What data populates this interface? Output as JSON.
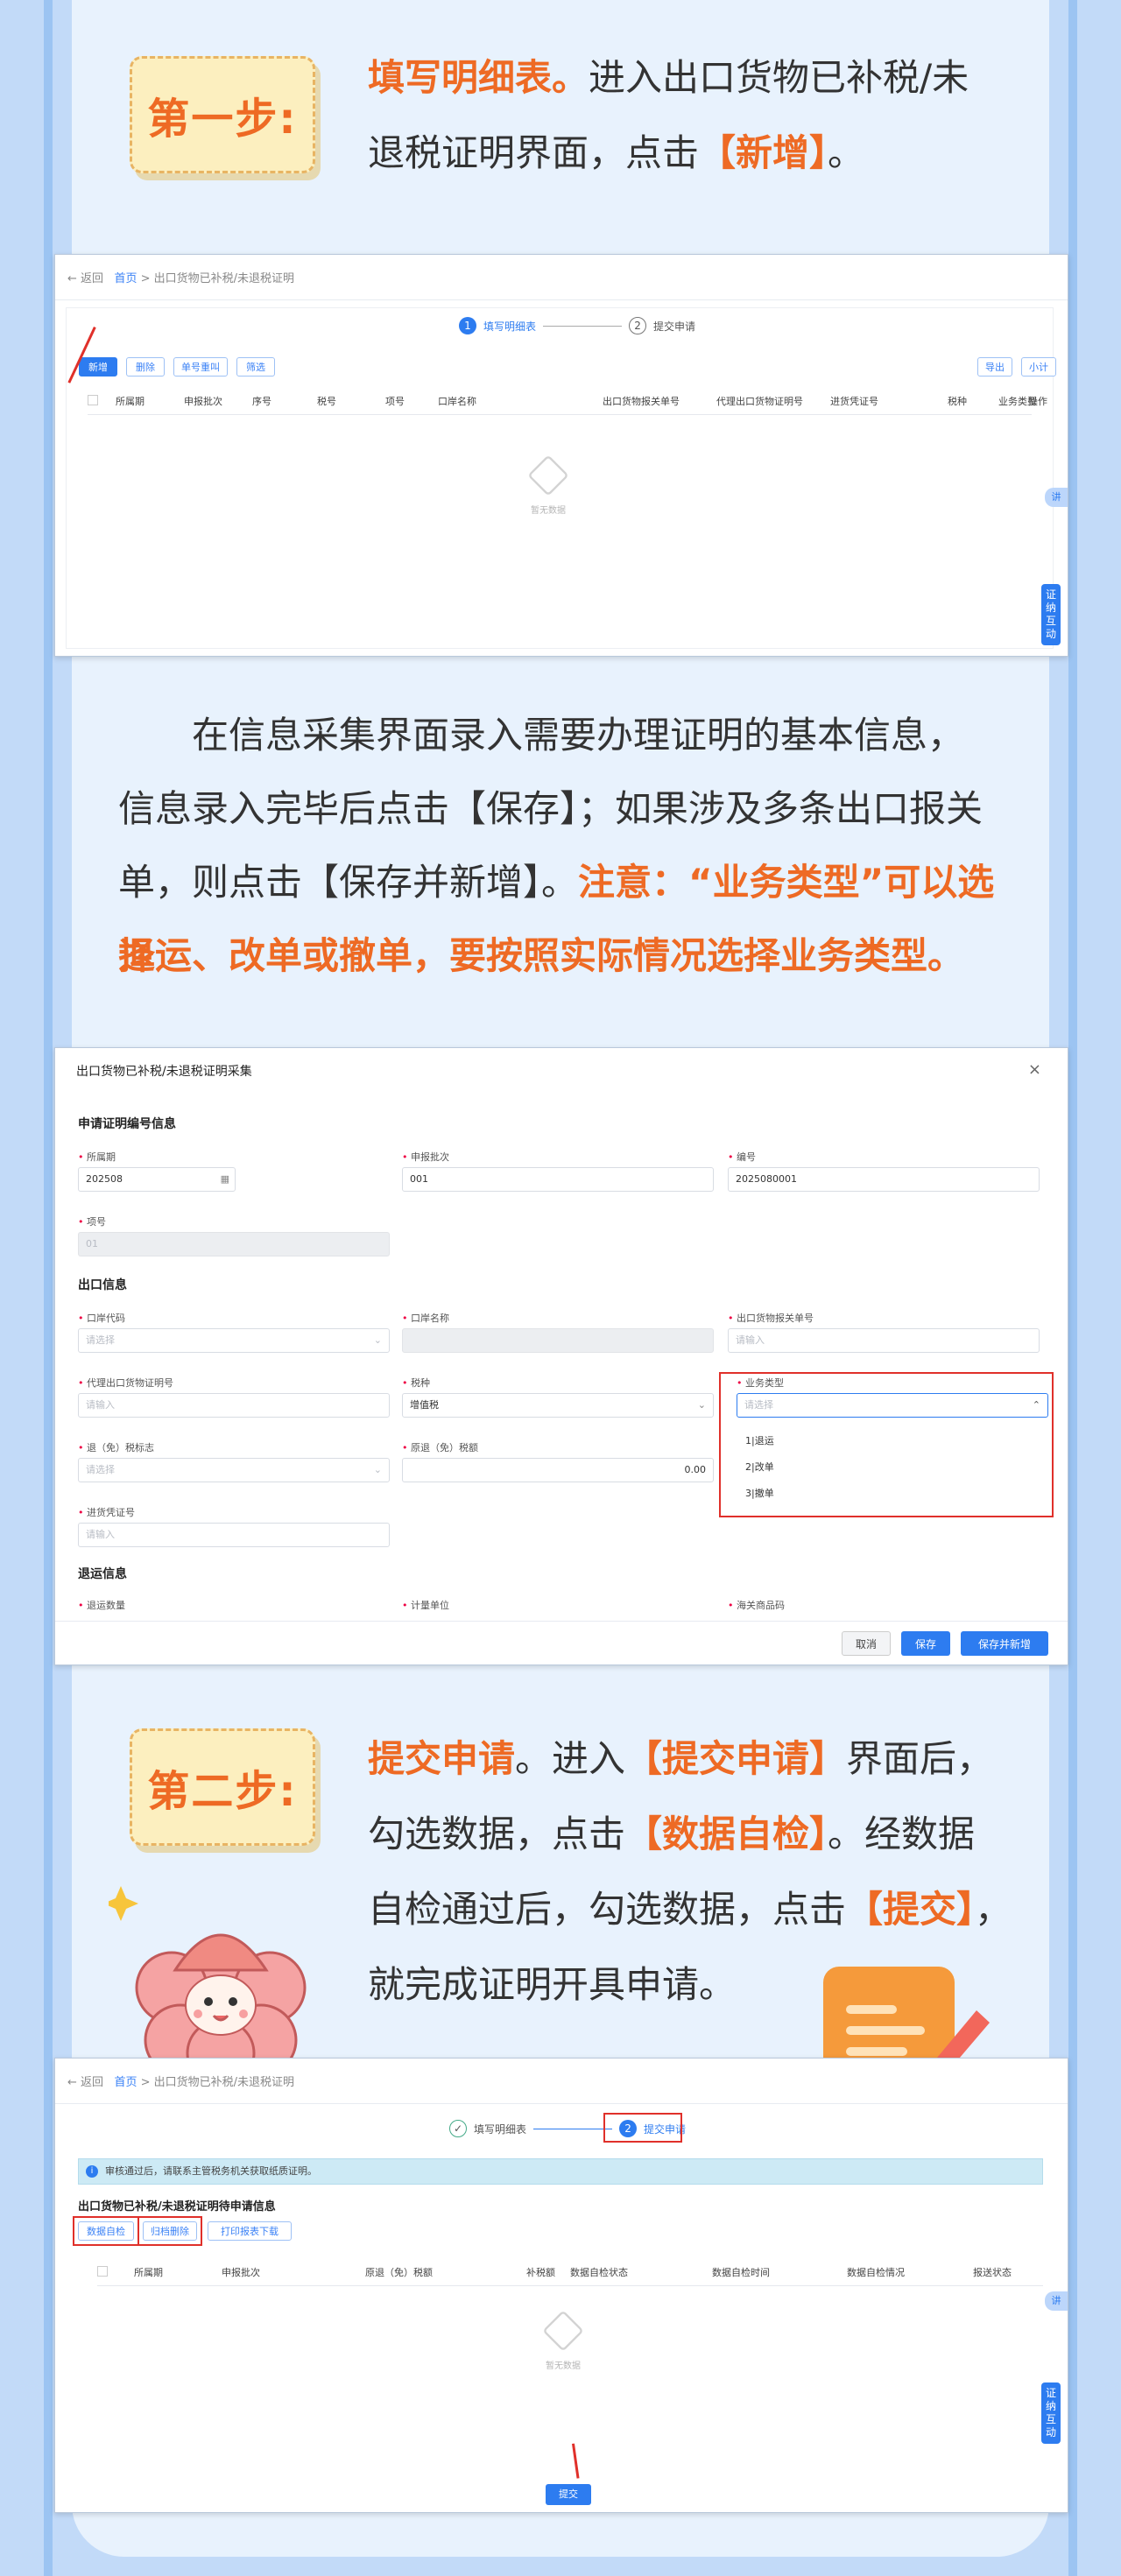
{
  "step1": {
    "badge": "第一步:",
    "title": "填写明细表。",
    "text1": "进入出口货物已补税/未",
    "text2_a": "退税证明界面，点击",
    "text2_b": "【新增】",
    "text2_c": "。"
  },
  "screen1": {
    "back": "← 返回",
    "home": "首页",
    "crumb": " > 出口货物已补税/未退税证明",
    "step1_num": "1",
    "step1": "填写明细表",
    "step2_num": "2",
    "step2": "提交申请",
    "buttons": [
      "新增",
      "删除",
      "单号重叫",
      "筛选"
    ],
    "right_buttons": [
      "导出",
      "小计"
    ],
    "columns": [
      "所属期",
      "申报批次",
      "序号",
      "税号",
      "项号",
      "口岸名称",
      "出口货物报关单号",
      "代理出口货物证明号",
      "进货凭证号",
      "税种",
      "业务类型",
      "操作"
    ],
    "empty": "暂无数据",
    "side_dot": "讲",
    "side_tab": "证纳互动"
  },
  "para": {
    "l1": "在信息采集界面录入需要办理证明的基本信息，",
    "l2": "信息录入完毕后点击【保存】；如果涉及多条出口报关",
    "l3_a": "单，则点击【保存并新增】。",
    "l3_b": "注意：“业务类型”可以选择",
    "l4": "退运、改单或撤单，要按照实际情况选择业务类型。"
  },
  "dialog": {
    "title": "出口货物已补税/未退税证明采集",
    "close": "×",
    "sec1": "申请证明编号信息",
    "f_ssq": "所属期",
    "v_ssq": "202508",
    "f_pc": "申报批次",
    "v_pc": "001",
    "f_bh": "编号",
    "v_bh": "2025080001",
    "f_xh": "项号",
    "v_xh": "01",
    "sec2": "出口信息",
    "f_kadm": "口岸代码",
    "ph_select": "请选择",
    "f_kamc": "口岸名称",
    "f_bgd": "出口货物报关单号",
    "ph_input": "请输入",
    "f_dlzm": "代理出口货物证明号",
    "f_sz": "税种",
    "v_sz": "增值税",
    "f_ywlx": "业务类型",
    "opts": [
      "1|退运",
      "2|改单",
      "3|撤单"
    ],
    "f_tmsbz": "退（免）税标志",
    "f_ytmse": "原退（免）税额",
    "v_ytmse": "0.00",
    "f_jhpz": "进货凭证号",
    "sec3": "退运信息",
    "f_tysl": "退运数量",
    "f_jldw": "计量单位",
    "f_hsh": "海关商品码",
    "cancel": "取消",
    "save": "保存",
    "save_new": "保存并新增"
  },
  "step2": {
    "badge": "第二步:",
    "t1_a": "提交申请",
    "t1_b": "。进入",
    "t1_c": "【提交申请】",
    "t1_d": "界面后，",
    "t2_a": "勾选数据，点击",
    "t2_b": "【数据自检】",
    "t2_c": "。经数据",
    "t3_a": "自检通过后，勾选数据，点击",
    "t3_b": "【提交】",
    "t3_c": "，",
    "t4": "就完成证明开具申请。"
  },
  "screen2": {
    "back": "← 返回",
    "home": "首页",
    "crumb": " > 出口货物已补税/未退税证明",
    "step1": "填写明细表",
    "step2_num": "2",
    "step2": "提交申请",
    "info": "审核通过后，请联系主管税务机关获取纸质证明。",
    "table_title": "出口货物已补税/未退税证明待申请信息",
    "buttons": [
      "数据自检",
      "归档删除",
      "打印报表下载"
    ],
    "columns": [
      "所属期",
      "申报批次",
      "原退（免）税额",
      "补税额",
      "数据自检状态",
      "数据自检时间",
      "数据自检情况",
      "报送状态"
    ],
    "empty": "暂无数据",
    "submit": "提交",
    "side_dot": "讲",
    "side_tab": "证纳互动"
  }
}
